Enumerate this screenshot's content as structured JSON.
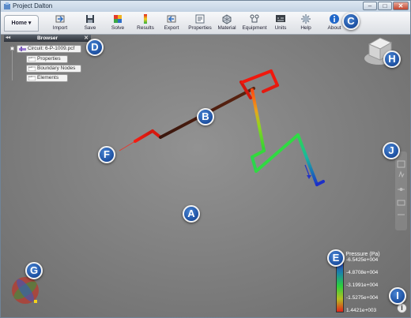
{
  "window": {
    "title": "Project Dalton",
    "min": "–",
    "max": "□",
    "close": "✕"
  },
  "ribbon": {
    "home_tab": "Home ▾",
    "buttons": [
      {
        "label": "Import",
        "icon": "import-icon"
      },
      {
        "label": "Save",
        "icon": "save-icon"
      },
      {
        "label": "Solve",
        "icon": "solve-icon"
      },
      {
        "label": "Results",
        "icon": "results-icon"
      },
      {
        "label": "Export",
        "icon": "export-icon"
      },
      {
        "label": "Properties",
        "icon": "properties-icon"
      },
      {
        "label": "Material",
        "icon": "material-icon"
      },
      {
        "label": "Equipment",
        "icon": "equipment-icon"
      },
      {
        "label": "Units",
        "icon": "units-icon"
      },
      {
        "label": "Help",
        "icon": "help-icon"
      },
      {
        "label": "About",
        "icon": "info-icon"
      }
    ]
  },
  "browser": {
    "title": "Browser",
    "collapse": "◂◂",
    "close": "✕",
    "root": "Circuit: 6-P-1009.pcf",
    "children": [
      "Properties",
      "Boundary Nodes",
      "Elements"
    ]
  },
  "callouts": [
    "A",
    "B",
    "C",
    "D",
    "E",
    "F",
    "G",
    "H",
    "I",
    "J"
  ],
  "legend": {
    "title": "Pressure (Pa)",
    "labels": [
      "-6.5425e+004",
      "-4.8708e+004",
      "-3.1991e+004",
      "-1.5275e+004",
      "1.4421e+003"
    ]
  },
  "info_glyph": "i"
}
